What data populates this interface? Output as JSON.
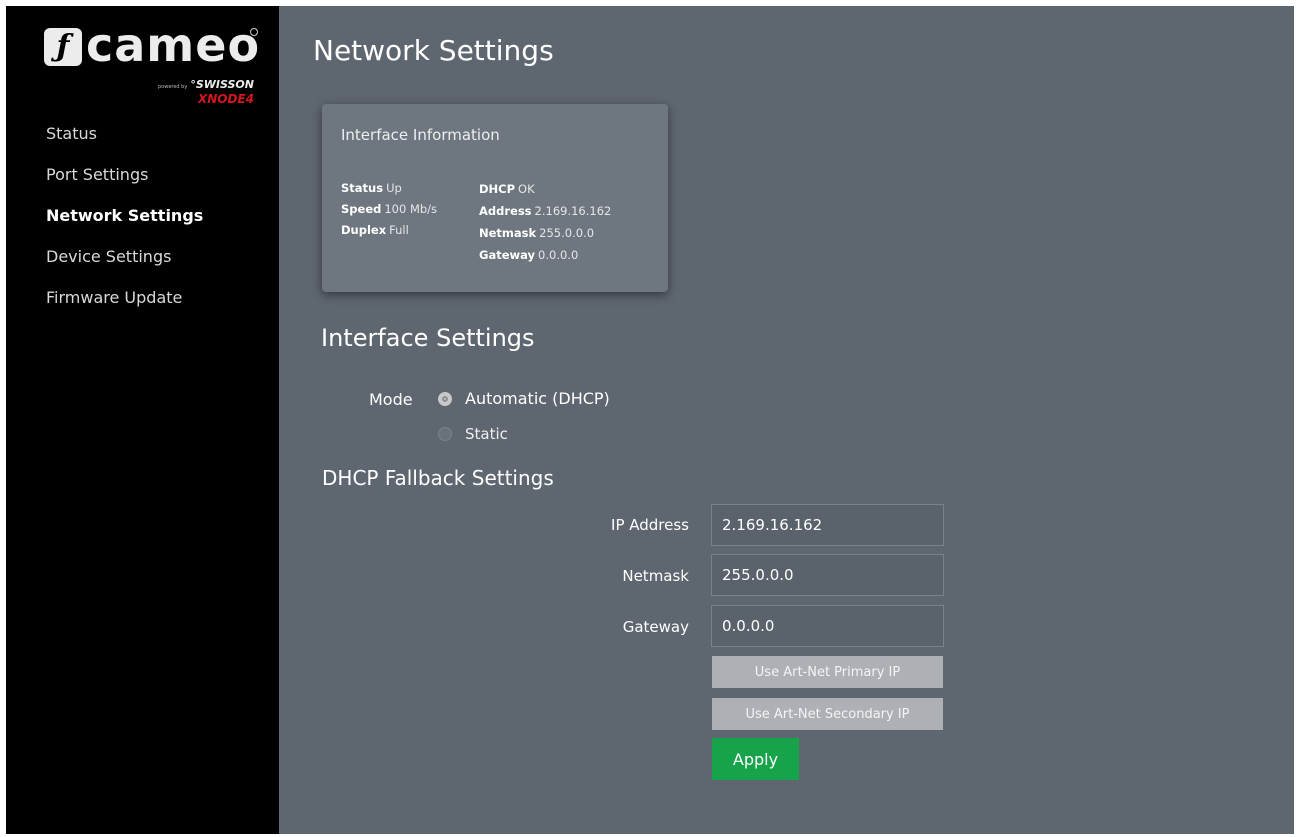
{
  "brand": {
    "mark": "ƒ",
    "name": "cameo",
    "powered_by": "powered by",
    "partner": "°SWISSON",
    "product": "XNODE4"
  },
  "sidebar": {
    "items": [
      {
        "label": "Status",
        "active": false
      },
      {
        "label": "Port Settings",
        "active": false
      },
      {
        "label": "Network Settings",
        "active": true
      },
      {
        "label": "Device Settings",
        "active": false
      },
      {
        "label": "Firmware Update",
        "active": false
      }
    ]
  },
  "page": {
    "title": "Network Settings"
  },
  "interface_info": {
    "title": "Interface Information",
    "status_label": "Status",
    "status_value": "Up",
    "speed_label": "Speed",
    "speed_value": "100 Mb/s",
    "duplex_label": "Duplex",
    "duplex_value": "Full",
    "dhcp_label": "DHCP",
    "dhcp_value": "OK",
    "address_label": "Address",
    "address_value": "2.169.16.162",
    "netmask_label": "Netmask",
    "netmask_value": "255.0.0.0",
    "gateway_label": "Gateway",
    "gateway_value": "0.0.0.0"
  },
  "interface_settings": {
    "title": "Interface Settings",
    "mode_label": "Mode",
    "options": [
      {
        "label": "Automatic (DHCP)",
        "selected": true
      },
      {
        "label": "Static",
        "selected": false
      }
    ]
  },
  "fallback": {
    "title": "DHCP Fallback Settings",
    "ip_label": "IP Address",
    "ip_value": "2.169.16.162",
    "netmask_label": "Netmask",
    "netmask_value": "255.0.0.0",
    "gateway_label": "Gateway",
    "gateway_value": "0.0.0.0",
    "primary_button": "Use Art-Net Primary IP",
    "secondary_button": "Use Art-Net Secondary IP",
    "apply_button": "Apply"
  },
  "colors": {
    "sidebar_bg": "#000000",
    "main_bg": "#5e6670",
    "card_bg": "#6e7780",
    "apply_green": "#16a34a",
    "brand_red": "#d4161e"
  }
}
